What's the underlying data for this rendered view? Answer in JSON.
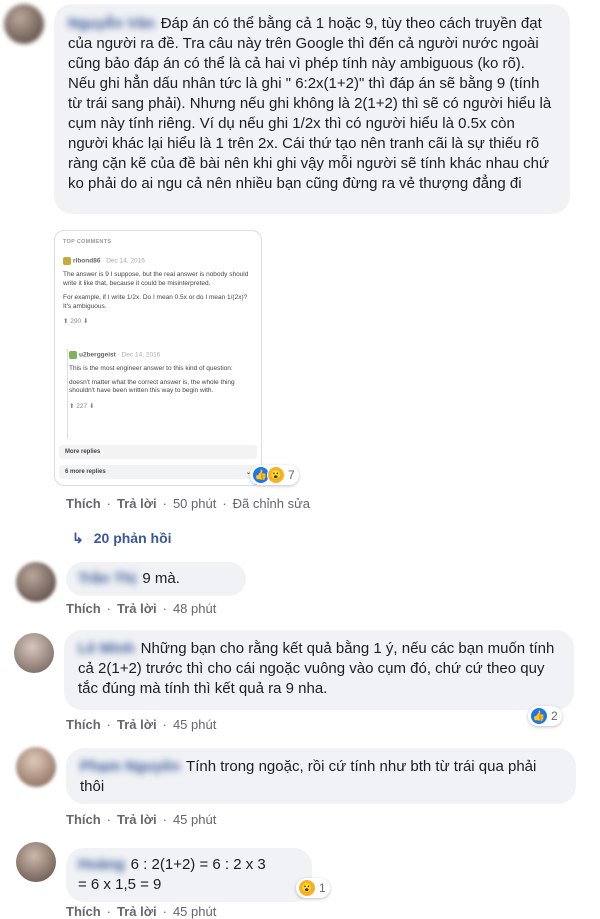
{
  "comment1": {
    "author": "Nguyễn Văn",
    "text": "Đáp án có thể bằng cả 1 hoặc 9, tùy theo cách truyền đạt của người ra đề. Tra câu này trên Google thì đến cả người nước ngoài cũng bảo đáp án có thể là cả hai vì phép tính này ambiguous (ko rõ). Nếu ghi hẳn dấu nhân tức là ghi \" 6:2x(1+2)\" thì đáp án sẽ bằng 9 (tính từ trái sang phải). Nhưng nếu ghi không là 2(1+2) thì sẽ có người hiểu là cụm này tính riêng. Ví dụ nếu ghi 1/2x thì có người hiểu là 0.5x còn người khác lại hiểu là 1 trên 2x. Cái thứ tạo nên tranh cãi là sự thiếu rõ ràng cặn kẽ của đề bài nên khi ghi vậy mỗi người sẽ tính khác nhau chứ ko phải do ai ngu cả nên nhiều bạn cũng đừng ra vẻ thượng đẳng đi",
    "embed": {
      "header": "TOP COMMENTS",
      "top_user": "rlbond86",
      "top_date": "· Dec 14, 2016",
      "top_line1": "The answer is 9 I suppose, but the real answer is nobody should write it like that, because it could be misinterpreted.",
      "top_line2": "For example, if I write 1/2x. Do I mean 0.5x or do I mean 1/(2x)? It's ambiguous.",
      "top_votes": "290",
      "reply_user": "u2berggeist",
      "reply_date": "· Dec 14, 2016",
      "reply_line1": "This is the most engineer answer to this kind of question:",
      "reply_line2": "doesn't matter what the correct answer is, the whole thing shouldn't have been written this way to begin with.",
      "reply_votes": "227",
      "more_replies": "More replies",
      "more_replies_count": "6 more replies"
    },
    "reaction_count": "7",
    "actions": {
      "like": "Thích",
      "reply": "Trả lời",
      "time": "50 phút",
      "edited": "Đã chỉnh sửa"
    },
    "replies_link": "20 phản hồi"
  },
  "comment2": {
    "author": "Trần Thị",
    "text": "9 mà.",
    "actions": {
      "like": "Thích",
      "reply": "Trả lời",
      "time": "48 phút"
    }
  },
  "comment3": {
    "author": "Lê Minh",
    "text": "Những bạn cho rằng kết quả bằng 1 ý, nếu các bạn muốn tính cả 2(1+2) trước thì cho cái ngoặc vuông vào cụm đó, chứ cứ theo quy tắc đúng mà tính thì kết quả ra 9 nha.",
    "reaction_count": "2",
    "actions": {
      "like": "Thích",
      "reply": "Trả lời",
      "time": "45 phút"
    }
  },
  "comment4": {
    "author": "Phạm Nguyên",
    "text": "Tính trong ngoặc, rồi cứ tính như bth từ trái qua phải thôi",
    "actions": {
      "like": "Thích",
      "reply": "Trả lời",
      "time": "45 phút"
    }
  },
  "comment5": {
    "author": "Hoàng",
    "line1": "6 : 2(1+2) = 6 : 2 x 3",
    "line2": "= 6 x 1,5 = 9",
    "reaction_count": "1",
    "actions": {
      "like": "Thích",
      "reply": "Trả lời",
      "time": "45 phút"
    }
  },
  "colors": {
    "link": "#385898",
    "bubble": "#f0f2f5",
    "muted": "#65676b",
    "like": "#1877f2",
    "wow": "#f7b125"
  }
}
